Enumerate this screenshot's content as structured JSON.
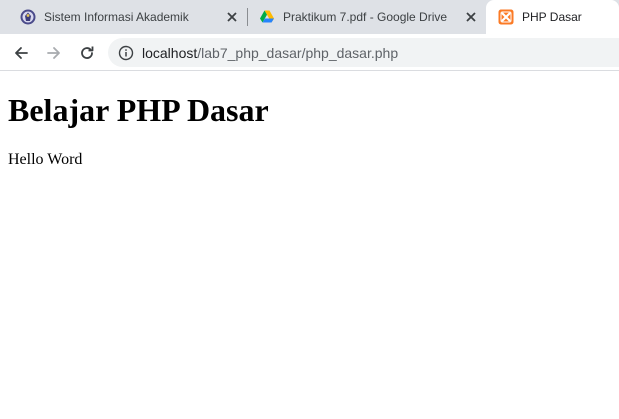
{
  "tabs": [
    {
      "title": "Sistem Informasi Akademik",
      "favicon": "university-seal-icon",
      "active": false
    },
    {
      "title": "Praktikum 7.pdf - Google Drive",
      "favicon": "google-drive-icon",
      "active": false
    },
    {
      "title": "PHP Dasar",
      "favicon": "xampp-icon",
      "active": true
    }
  ],
  "address_bar": {
    "host": "localhost",
    "path": "/lab7_php_dasar/php_dasar.php"
  },
  "page": {
    "heading": "Belajar PHP Dasar",
    "body_text": "Hello Word"
  },
  "colors": {
    "tabstrip_bg": "#dee1e6",
    "omnibox_bg": "#f1f3f4",
    "xampp_orange": "#fb7a24"
  }
}
